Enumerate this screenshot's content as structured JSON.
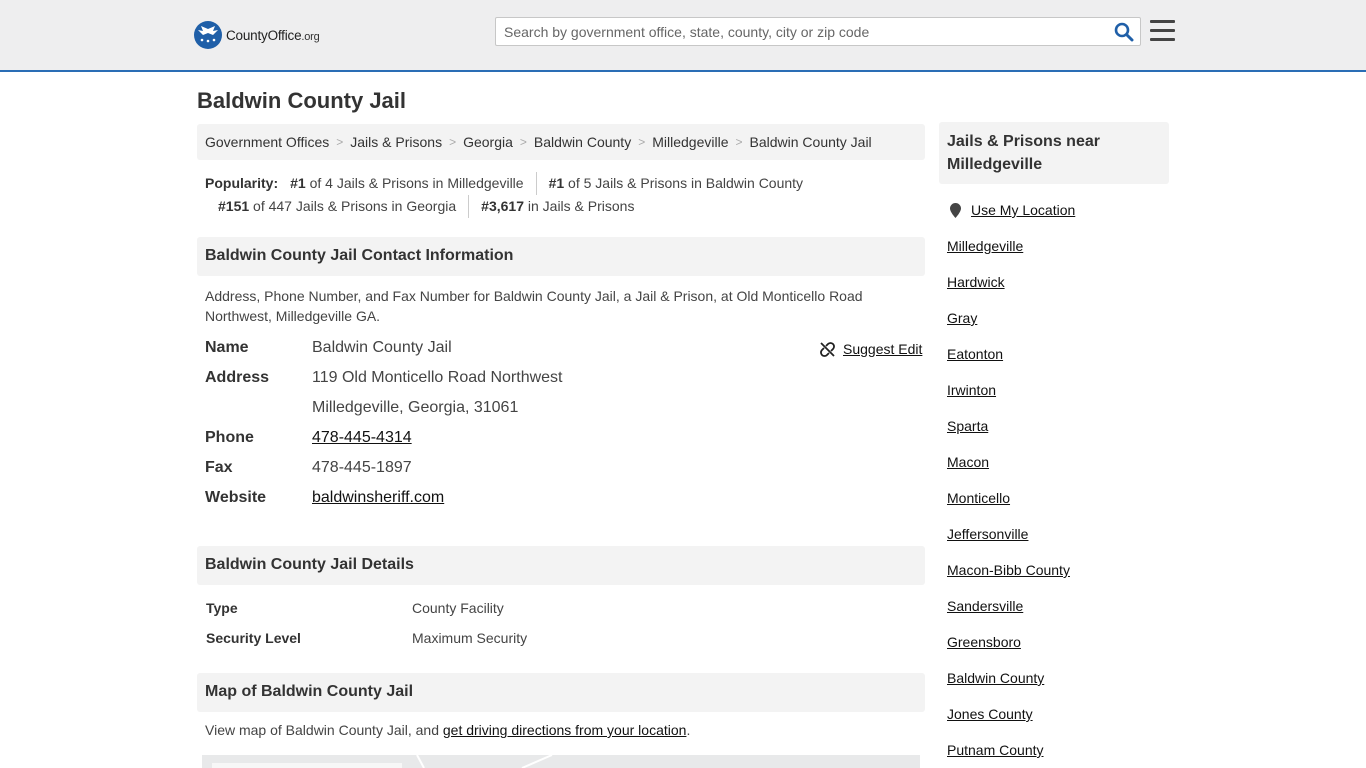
{
  "header": {
    "logo_text": "CountyOffice",
    "logo_suffix": ".org",
    "search_placeholder": "Search by government office, state, county, city or zip code"
  },
  "page": {
    "title": "Baldwin County Jail"
  },
  "breadcrumb": [
    "Government Offices",
    "Jails & Prisons",
    "Georgia",
    "Baldwin County",
    "Milledgeville",
    "Baldwin County Jail"
  ],
  "popularity": {
    "label": "Popularity:",
    "items": [
      {
        "rank": "#1",
        "text": "of 4 Jails & Prisons in Milledgeville"
      },
      {
        "rank": "#1",
        "text": "of 5 Jails & Prisons in Baldwin County"
      },
      {
        "rank": "#151",
        "text": "of 447 Jails & Prisons in Georgia"
      },
      {
        "rank": "#3,617",
        "text": "in Jails & Prisons"
      }
    ]
  },
  "contact": {
    "heading": "Baldwin County Jail Contact Information",
    "description": "Address, Phone Number, and Fax Number for Baldwin County Jail, a Jail & Prison, at Old Monticello Road Northwest, Milledgeville GA.",
    "suggest_edit": "Suggest Edit",
    "name_label": "Name",
    "name": "Baldwin County Jail",
    "address_label": "Address",
    "address_line1": "119 Old Monticello Road Northwest",
    "address_line2": "Milledgeville, Georgia, 31061",
    "phone_label": "Phone",
    "phone": "478-445-4314",
    "fax_label": "Fax",
    "fax": "478-445-1897",
    "website_label": "Website",
    "website": "baldwinsheriff.com"
  },
  "details": {
    "heading": "Baldwin County Jail Details",
    "type_label": "Type",
    "type": "County Facility",
    "security_label": "Security Level",
    "security": "Maximum Security"
  },
  "map": {
    "heading": "Map of Baldwin County Jail",
    "text_before": "View map of Baldwin County Jail, and ",
    "link": "get driving directions from your location",
    "text_after": "."
  },
  "sidebar": {
    "heading": "Jails & Prisons near Milledgeville",
    "use_location": "Use My Location",
    "items": [
      "Milledgeville",
      "Hardwick",
      "Gray",
      "Eatonton",
      "Irwinton",
      "Sparta",
      "Macon",
      "Monticello",
      "Jeffersonville",
      "Macon-Bibb County",
      "Sandersville",
      "Greensboro",
      "Baldwin County",
      "Jones County",
      "Putnam County"
    ]
  }
}
